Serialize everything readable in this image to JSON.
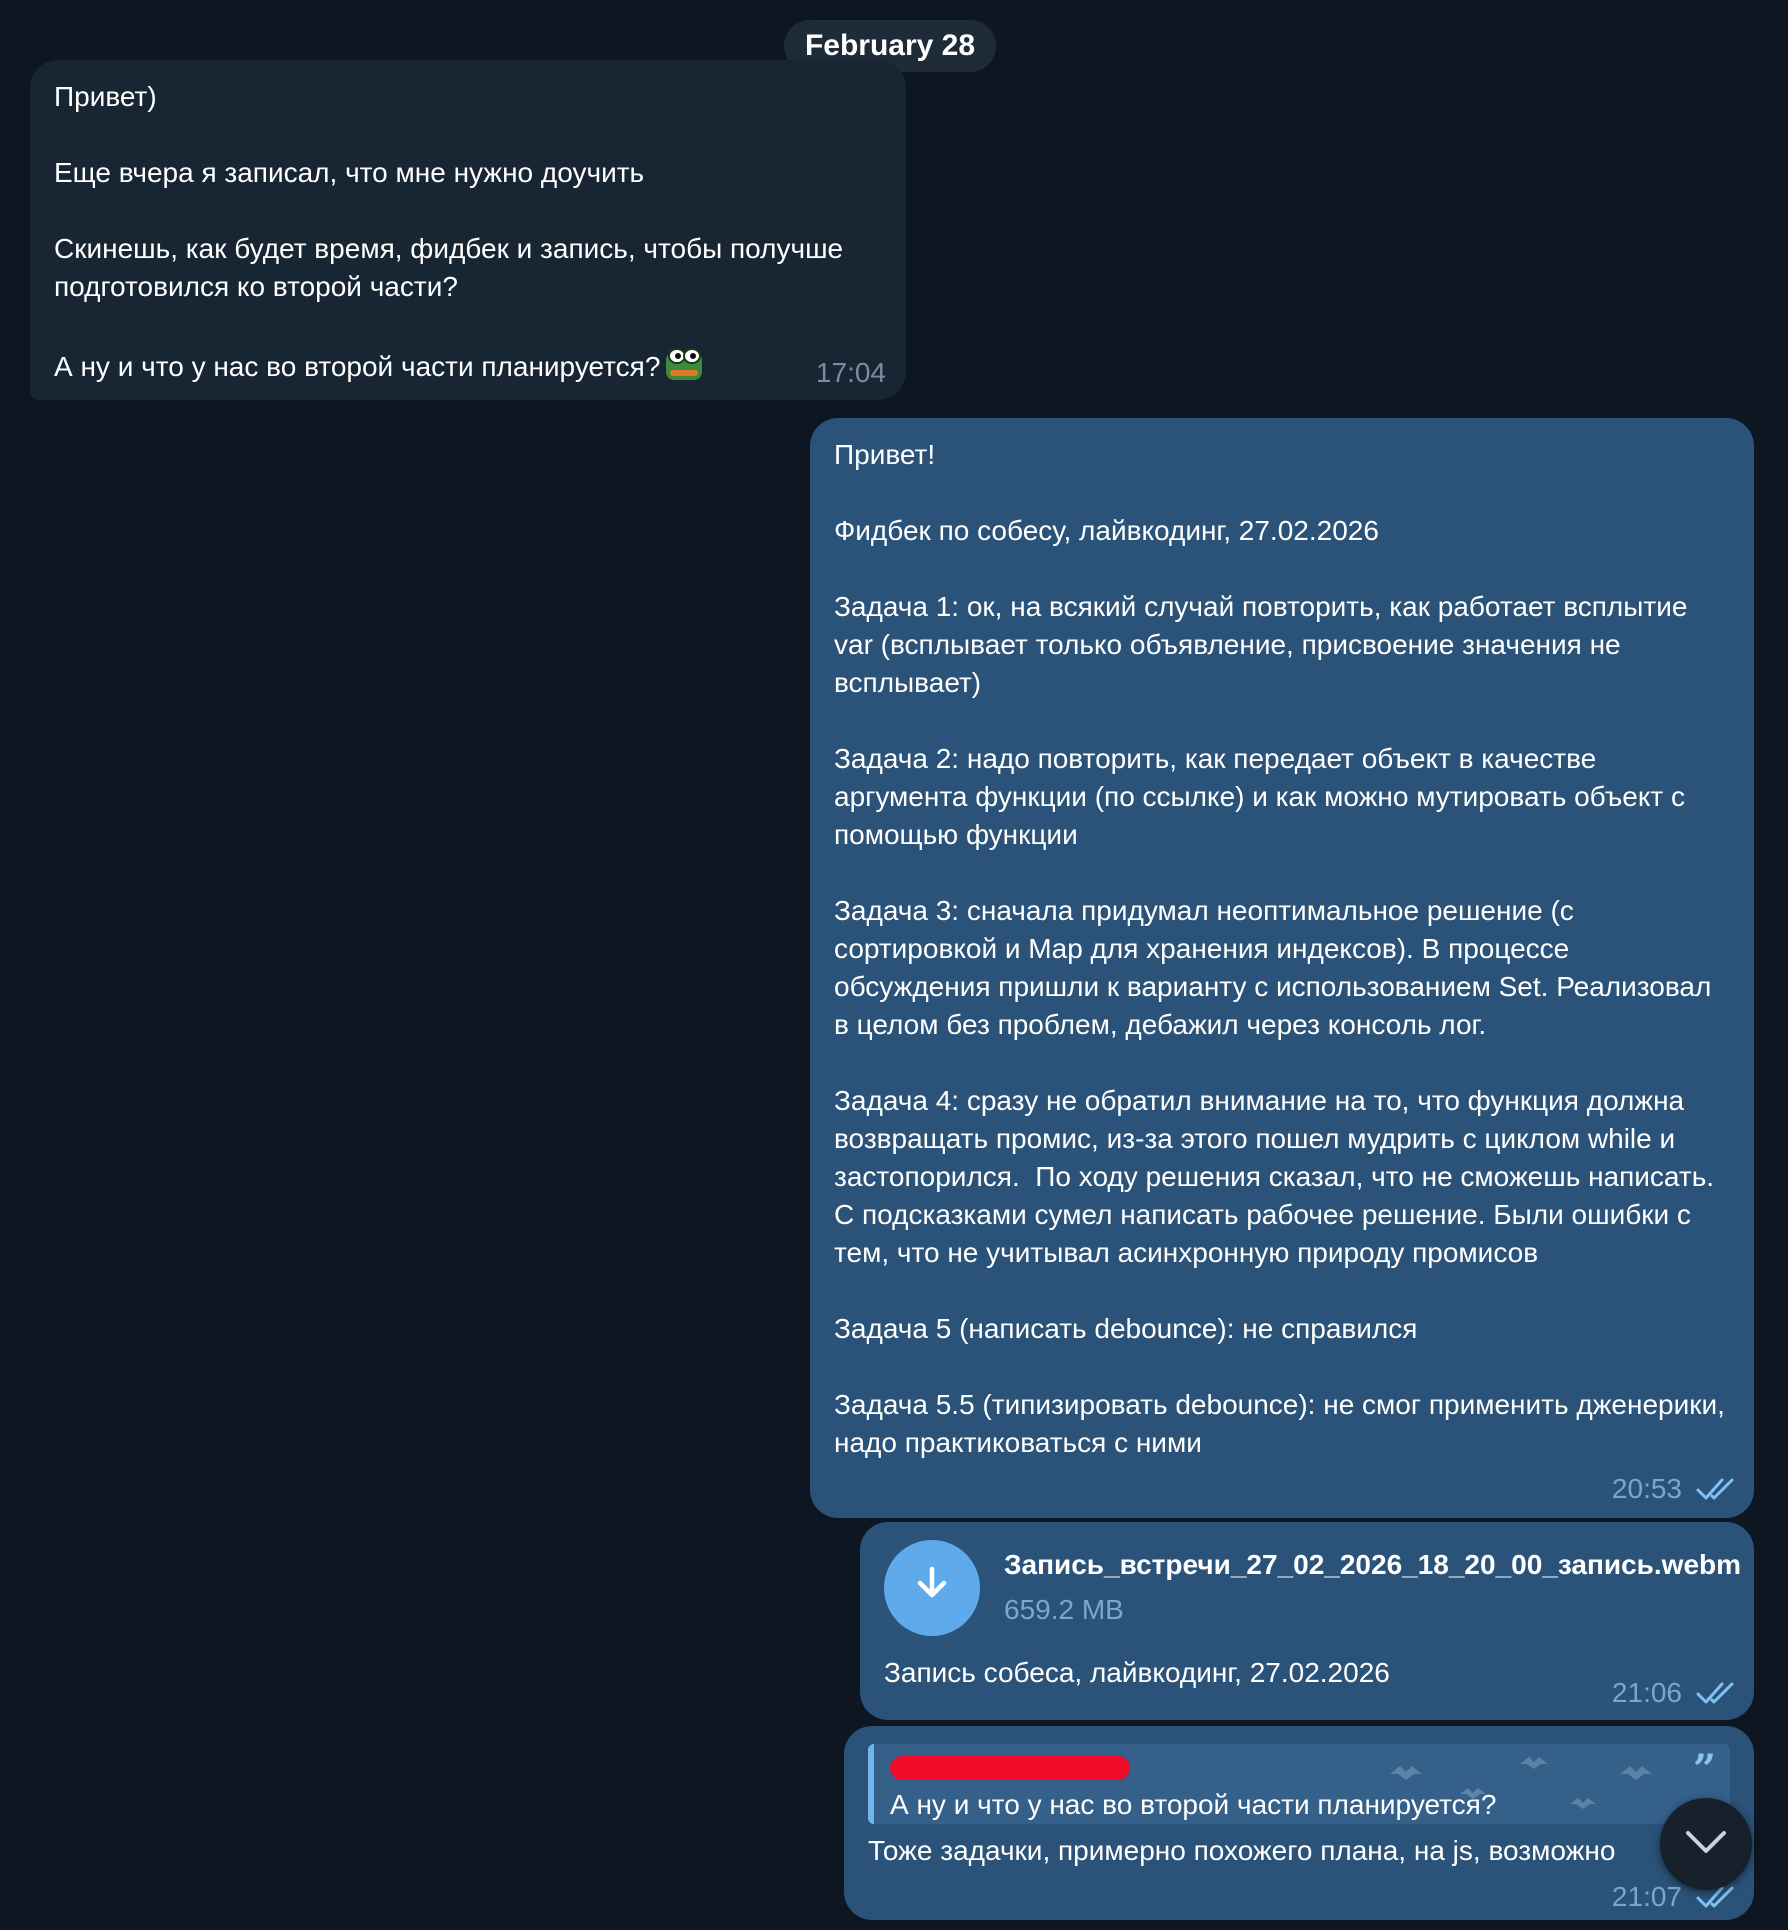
{
  "date_separator": "February 28",
  "messages": [
    {
      "direction": "incoming",
      "text": "Привет)\n\nЕще вчера я записал, что мне нужно доучить\n\nСкинешь, как будет время, фидбек и запись, чтобы получше подготовился ко второй части?\n\nА ну и что у нас во второй части планируется?",
      "sticker": "frog-emoji-icon",
      "time": "17:04"
    },
    {
      "direction": "outgoing",
      "text": "Привет!\n\nФидбек по собесу, лайвкодинг, 27.02.2026\n\nЗадача 1: ок, на всякий случай повторить, как работает всплытие var (всплывает только объявление, присвоение значения не всплывает)\n\nЗадача 2: надо повторить, как передает объект в качестве аргумента функции (по ссылке) и как можно мутировать объект с помощью функции\n\nЗадача 3: сначала придумал неоптимальное решение (с сортировкой и Map для хранения индексов). В процессе обсуждения пришли к варианту с использованием Set. Реализовал в целом без проблем, дебажил через консоль лог.\n\nЗадача 4: сразу не обратил внимание на то, что функция должна возвращать промис, из-за этого пошел мудрить с циклом while и застопорился.  По ходу решения сказал, что не сможешь написать. С подсказками сумел написать рабочее решение. Были ошибки с тем, что не учитывал асинхронную природу промисов\n\nЗадача 5 (написать debounce): не справился\n\nЗадача 5.5 (типизировать debounce): не смог применить дженерики, надо практиковаться с ними",
      "time": "20:53",
      "status": "read"
    },
    {
      "direction": "outgoing",
      "file_name": "Запись_встречи_27_02_2026_18_20_00_запись.webm",
      "file_size": "659.2 MB",
      "caption": "Запись собеса, лайвкодинг, 27.02.2026",
      "time": "21:06",
      "status": "read"
    },
    {
      "direction": "outgoing",
      "reply_quote": "А ну и что у нас во второй части планируется?",
      "text": "Тоже задачки, примерно похожего плана, на js, возможно",
      "time": "21:07",
      "status": "read"
    }
  ],
  "icons": {
    "download": "download-arrow-icon",
    "read_status": "double-check-icon",
    "quote": "quote-icon",
    "scroll": "chevron-down-icon"
  },
  "colors": {
    "background": "#0e1621",
    "incoming_bubble": "#182533",
    "outgoing_bubble": "#2b5278",
    "accent": "#5eaaeb",
    "redaction": "#f00a2a"
  }
}
